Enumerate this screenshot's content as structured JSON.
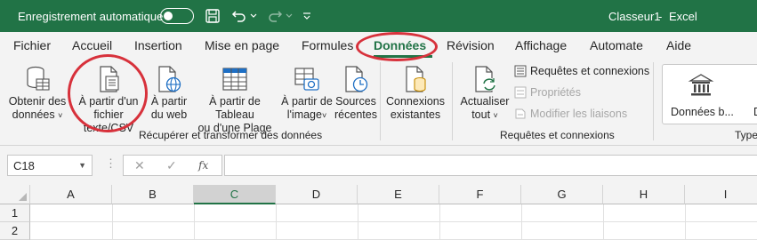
{
  "titlebar": {
    "autosave_label": "Enregistrement automatique",
    "autosave_state": "off",
    "doc_title": "Classeur1",
    "separator": "-",
    "app_name": "Excel",
    "bg_color": "#217346",
    "qat_icons": [
      "save-icon",
      "undo-icon",
      "redo-icon",
      "customize-icon"
    ]
  },
  "tabs": [
    {
      "label": "Fichier",
      "active": false
    },
    {
      "label": "Accueil",
      "active": false
    },
    {
      "label": "Insertion",
      "active": false
    },
    {
      "label": "Mise en page",
      "active": false
    },
    {
      "label": "Formules",
      "active": false
    },
    {
      "label": "Données",
      "active": true
    },
    {
      "label": "Révision",
      "active": false
    },
    {
      "label": "Affichage",
      "active": false
    },
    {
      "label": "Automate",
      "active": false
    },
    {
      "label": "Aide",
      "active": false
    }
  ],
  "ribbon": {
    "get_transform": {
      "group_label": "Récupérer et transformer des données",
      "commands": [
        {
          "line1": "Obtenir des",
          "line2": "données",
          "caret": "˅",
          "icon": "database-icon"
        },
        {
          "line1": "À partir d'un",
          "line2": "fichier texte/CSV",
          "caret": "",
          "icon": "text-file-icon"
        },
        {
          "line1": "À partir",
          "line2": "du web",
          "caret": "",
          "icon": "web-icon"
        },
        {
          "line1": "À partir de Tableau",
          "line2": "ou d'une Plage",
          "caret": "",
          "icon": "table-icon"
        },
        {
          "line1": "À partir de",
          "line2": "l'image",
          "caret": "˅",
          "icon": "image-icon"
        },
        {
          "line1": "Sources",
          "line2": "récentes",
          "caret": "",
          "icon": "recent-sources-icon"
        },
        {
          "line1": "Connexions",
          "line2": "existantes",
          "caret": "",
          "icon": "existing-connections-icon"
        }
      ]
    },
    "queries": {
      "group_label": "Requêtes et connexions",
      "refresh": {
        "line1": "Actualiser",
        "line2": "tout",
        "caret": "˅"
      },
      "items": [
        {
          "label": "Requêtes et connexions",
          "enabled": true,
          "icon": "queries-icon"
        },
        {
          "label": "Propriétés",
          "enabled": false,
          "icon": "properties-icon"
        },
        {
          "label": "Modifier les liaisons",
          "enabled": false,
          "icon": "edit-links-icon"
        }
      ]
    },
    "types": {
      "group_label": "Types",
      "button_label": "Données b...",
      "next_letter": "D"
    }
  },
  "formula_bar": {
    "name_box": "C18",
    "cancel_glyph": "✕",
    "enter_glyph": "✓",
    "fx_label": "fx",
    "formula": ""
  },
  "grid": {
    "columns": [
      "A",
      "B",
      "C",
      "D",
      "E",
      "F",
      "G",
      "H",
      "I"
    ],
    "selected_column": "C",
    "rows": [
      "1",
      "2"
    ]
  },
  "colors": {
    "accent": "#217346",
    "annotation_ring": "#d7313b"
  }
}
